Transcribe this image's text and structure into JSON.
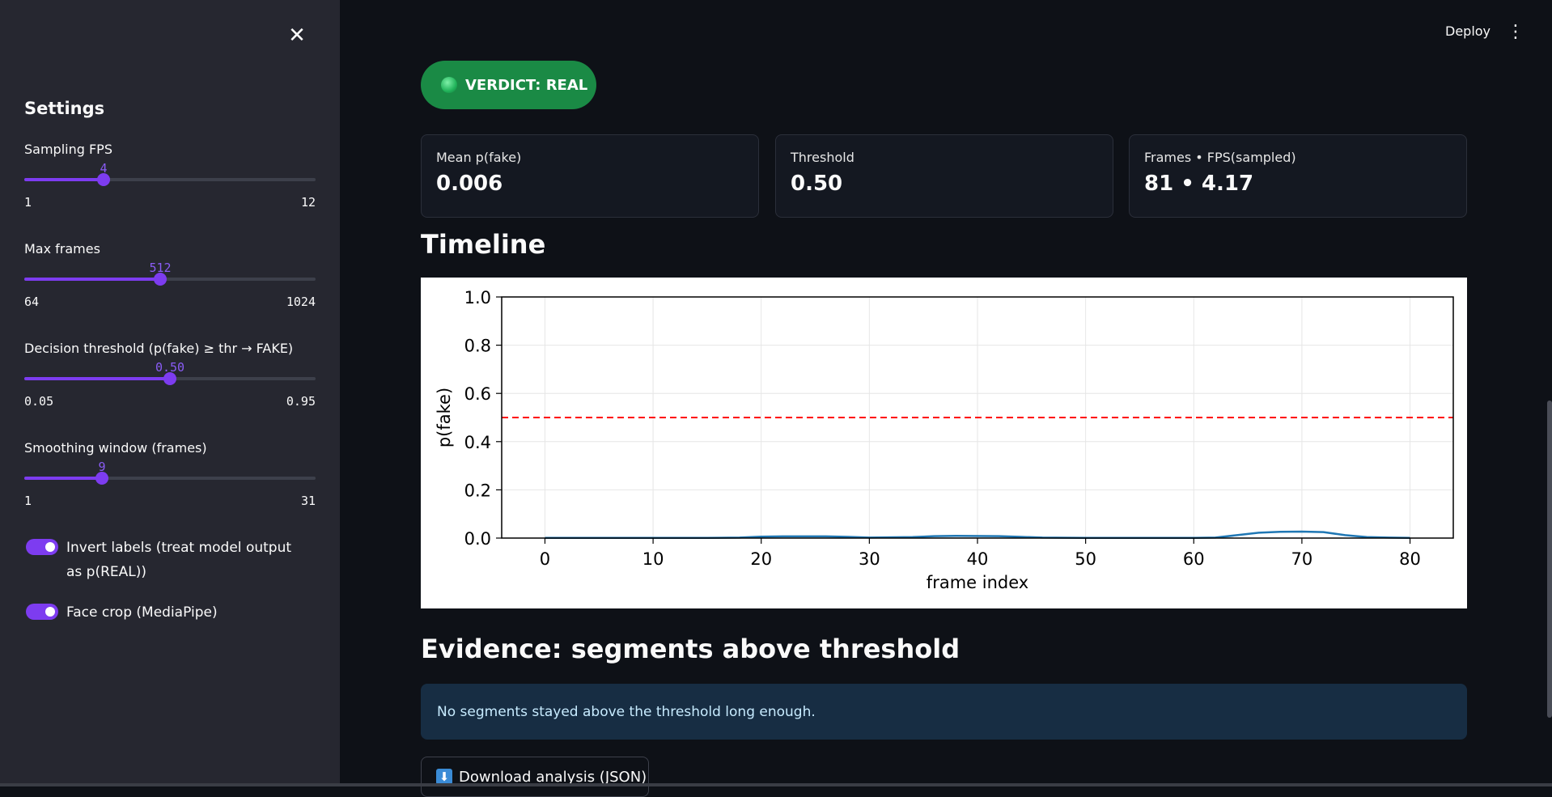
{
  "sidebar": {
    "title": "Settings",
    "sliders": [
      {
        "label": "Sampling FPS",
        "value": "4",
        "min": "1",
        "max": "12",
        "fraction": 0.273
      },
      {
        "label": "Max frames",
        "value": "512",
        "min": "64",
        "max": "1024",
        "fraction": 0.467
      },
      {
        "label": "Decision threshold (p(fake) ≥ thr → FAKE)",
        "value": "0.50",
        "min": "0.05",
        "max": "0.95",
        "fraction": 0.5
      },
      {
        "label": "Smoothing window (frames)",
        "value": "9",
        "min": "1",
        "max": "31",
        "fraction": 0.267
      }
    ],
    "toggles": [
      {
        "label": "Invert labels (treat model output as p(REAL))",
        "on": true
      },
      {
        "label": "Face crop (MediaPipe)",
        "on": true
      }
    ]
  },
  "header": {
    "deploy_label": "Deploy"
  },
  "verdict": {
    "label": "VERDICT: REAL",
    "color": "#1a8a45"
  },
  "metrics": [
    {
      "label": "Mean p(fake)",
      "value": "0.006"
    },
    {
      "label": "Threshold",
      "value": "0.50"
    },
    {
      "label": "Frames • FPS(sampled)",
      "value": "81 • 4.17"
    }
  ],
  "timeline_heading": "Timeline",
  "evidence_heading": "Evidence: segments above threshold",
  "evidence_message": "No segments stayed above the threshold long enough.",
  "download_label": "Download analysis (JSON)",
  "chart_data": {
    "type": "line",
    "xlabel": "frame index",
    "ylabel": "p(fake)",
    "xlim": [
      -4,
      84
    ],
    "ylim": [
      0,
      1
    ],
    "xticks": [
      0,
      10,
      20,
      30,
      40,
      50,
      60,
      70,
      80
    ],
    "yticks": [
      "0.0",
      "0.2",
      "0.4",
      "0.6",
      "0.8",
      "1.0"
    ],
    "grid": true,
    "threshold": 0.5,
    "series": [
      {
        "color": "#1f77b4",
        "x": [
          0,
          5,
          10,
          15,
          18,
          20,
          22,
          26,
          28,
          30,
          34,
          36,
          38,
          42,
          44,
          46,
          50,
          55,
          60,
          62,
          64,
          66,
          68,
          70,
          72,
          74,
          76,
          78,
          80
        ],
        "values": [
          0.001,
          0.001,
          0.001,
          0.001,
          0.002,
          0.006,
          0.007,
          0.007,
          0.005,
          0.002,
          0.004,
          0.008,
          0.009,
          0.008,
          0.005,
          0.002,
          0.001,
          0.001,
          0.001,
          0.002,
          0.012,
          0.022,
          0.026,
          0.027,
          0.025,
          0.012,
          0.004,
          0.002,
          0.001
        ]
      }
    ],
    "threshold_color": "#ff0000"
  }
}
